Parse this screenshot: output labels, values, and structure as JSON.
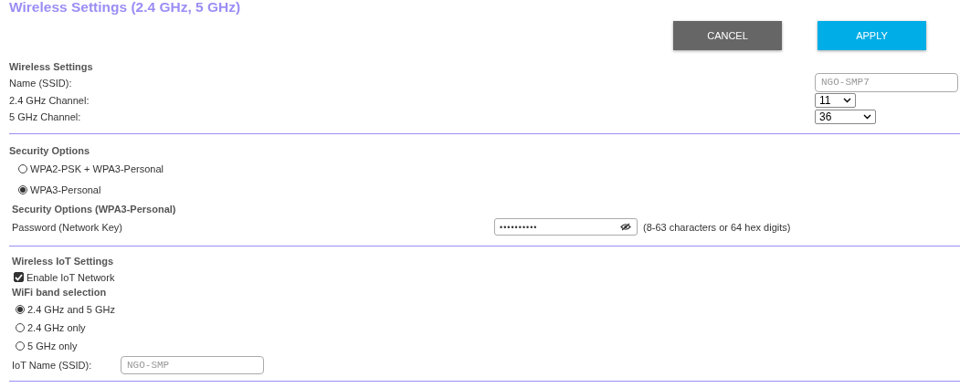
{
  "title": "Wireless Settings (2.4 GHz, 5 GHz)",
  "buttons": [
    {
      "label": "CANCEL",
      "kind": "secondary"
    },
    {
      "label": "APPLY",
      "kind": "primary"
    }
  ],
  "wireless": {
    "heading": "Wireless Settings",
    "ssid": {
      "label": "Name (SSID):",
      "placeholder": "NGO-SMP7"
    },
    "channels": [
      {
        "label": "2.4 GHz Channel:",
        "value": "11",
        "kind": "narrow"
      },
      {
        "label": "5 GHz Channel:",
        "value": "36",
        "kind": "wide"
      }
    ]
  },
  "security": {
    "heading": "Security Options",
    "options": [
      {
        "label": "WPA2-PSK + WPA3-Personal",
        "selected": false
      },
      {
        "label": "WPA3-Personal",
        "selected": true
      }
    ],
    "subheading": "Security Options (WPA3-Personal)",
    "password": {
      "label": "Password (Network Key)",
      "value": "••••••••••",
      "hint": "(8-63 characters or 64 hex digits)"
    }
  },
  "iot": {
    "heading": "Wireless IoT Settings",
    "enable": {
      "label": "Enable IoT Network",
      "checked": true
    },
    "band_heading": "WiFi band selection",
    "bands": [
      {
        "label": "2.4 GHz and 5 GHz",
        "selected": true
      },
      {
        "label": "2.4 GHz only",
        "selected": false
      },
      {
        "label": "5 GHz only",
        "selected": false
      }
    ],
    "name": {
      "label": "IoT Name (SSID):",
      "placeholder": "NGO-SMP"
    }
  }
}
